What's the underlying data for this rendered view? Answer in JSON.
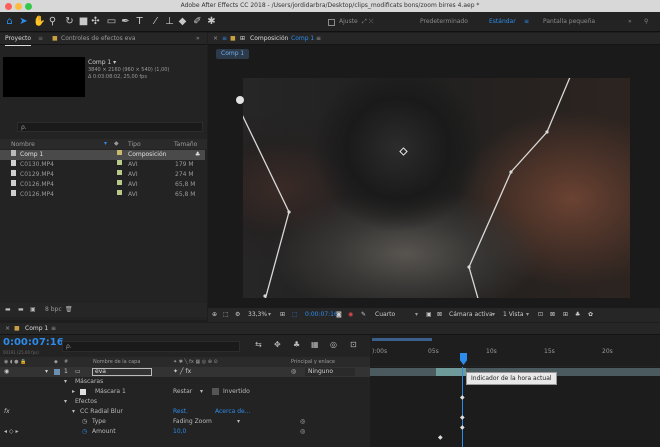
{
  "window": {
    "title": "Adobe After Effects CC 2018 - /Users/jordidarbra/Desktop/clips_modificats bons/zoom birres 4.aep *"
  },
  "toolbar": {
    "snap_label": "Ajuste",
    "workspaces": [
      "Predeterminado",
      "Estándar",
      "Pantalla pequeña"
    ]
  },
  "project_panel": {
    "tab_project": "Proyecto",
    "tab_effects": "Controles de efectos eva",
    "comp_name": "Comp 1 ▾",
    "comp_info_1": "3840 × 2160 (960 × 540) (1,00)",
    "comp_info_2": "Δ 0:03:08:02, 25,00 fps",
    "search_placeholder": "ρ.",
    "columns": {
      "name": "Nombre",
      "type": "Tipo",
      "size": "Tamaño"
    },
    "items": [
      {
        "name": "Comp 1",
        "type": "Composición",
        "size": "",
        "color": "#c9b96a"
      },
      {
        "name": "C0130.MP4",
        "type": "AVI",
        "size": "179 M",
        "color": "#b8c98a"
      },
      {
        "name": "C0129.MP4",
        "type": "AVI",
        "size": "274 M",
        "color": "#b8c98a"
      },
      {
        "name": "C0126.MP4",
        "type": "AVI",
        "size": "65,8 M",
        "color": "#b8c98a"
      },
      {
        "name": "C0126.MP4",
        "type": "AVI",
        "size": "65,8 M",
        "color": "#b8c98a"
      }
    ],
    "bpc": "8 bpc"
  },
  "composition_panel": {
    "tab_label": "Composición",
    "tab_comp": "Comp 1",
    "breadcrumb": "Comp 1",
    "zoom": "33,3%",
    "timecode": "0:00:07:16",
    "resolution": "Cuarto",
    "camera": "Cámara activa",
    "views": "1 Vista"
  },
  "timeline": {
    "tab_label": "Comp 1",
    "timecode": "0:00:07:16",
    "timecode_sub": "00191 (25.00 fps)",
    "search_placeholder": "ρ.",
    "col_layer_name": "Nombre de la capa",
    "col_parent": "Principal y enlace",
    "layer_num": "1",
    "layer_name": "eva",
    "parent_value": "Ninguno",
    "masks_label": "Máscaras",
    "mask1_label": "Máscara 1",
    "mask1_mode": "Restar",
    "mask1_inverted": "Invertido",
    "effects_label": "Efectos",
    "effect_name": "CC Radial Blur",
    "effect_reset": "Rest.",
    "effect_about": "Acerca de...",
    "prop_type": "Type",
    "prop_type_value": "Fading Zoom",
    "prop_amount": "Amount",
    "prop_amount_value": "10,0",
    "ruler": [
      "):00s",
      "05s",
      "10s",
      "15s",
      "20s"
    ],
    "tooltip": "Indicador de la hora actual"
  },
  "colors": {
    "accent": "#2d8ceb",
    "label_yellow": "#c9b96a",
    "label_green": "#b8c98a"
  }
}
